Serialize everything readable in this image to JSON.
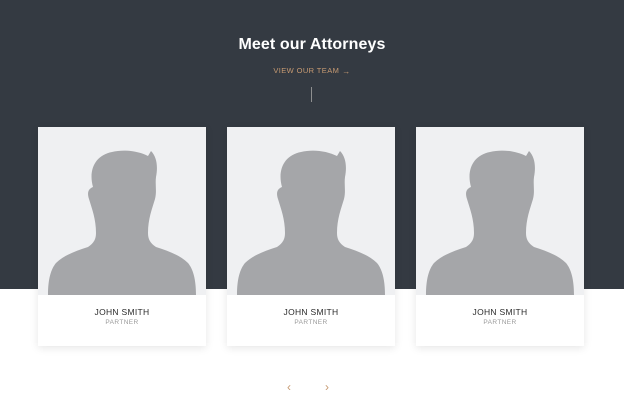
{
  "section": {
    "title": "Meet our Attorneys",
    "view_link_label": "VIEW OUR TEAM",
    "view_link_arrow": "→"
  },
  "attorneys": [
    {
      "name": "JOHN SMITH",
      "role": "PARTNER",
      "photo_icon": "avatar-placeholder-icon"
    },
    {
      "name": "JOHN SMITH",
      "role": "PARTNER",
      "photo_icon": "avatar-placeholder-icon"
    },
    {
      "name": "JOHN SMITH",
      "role": "PARTNER",
      "photo_icon": "avatar-placeholder-icon"
    }
  ],
  "carousel": {
    "prev_glyph": "‹",
    "next_glyph": "›"
  },
  "colors": {
    "band": "#343a42",
    "accent": "#c79a72",
    "photo_bg": "#eff0f2",
    "silhouette": "#a5a6a9"
  }
}
